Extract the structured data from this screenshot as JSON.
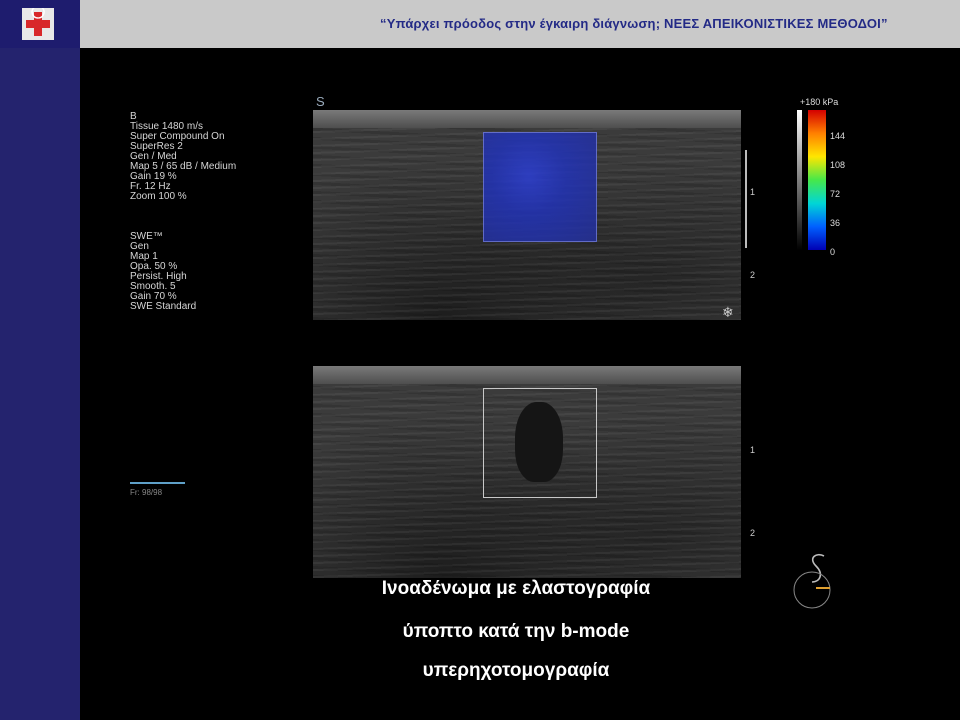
{
  "header": {
    "title": "“Υπάρχει πρόοδος στην έγκαιρη διάγνωση; ΝΕΕΣ ΑΠΕΙΚΟΝΙΣΤΙΚΕΣ ΜΕΘΟΔΟΙ”"
  },
  "params": {
    "bmode": [
      "B",
      "Tissue 1480 m/s",
      "Super Compound On",
      "SuperRes 2",
      "Gen / Med",
      "Map 5 / 65 dB / Medium",
      "Gain 19 %",
      "Fr. 12 Hz",
      "Zoom 100 %"
    ],
    "swe": [
      "SWE™",
      "Gen",
      "Map 1",
      "Opa. 50 %",
      "Persist. High",
      "Smooth. 5",
      "Gain 70 %",
      "SWE Standard"
    ]
  },
  "colorbar": {
    "labels": [
      "+180 kPa",
      "144",
      "108",
      "72",
      "36",
      "0"
    ]
  },
  "depth": {
    "top": [
      "1",
      "2"
    ],
    "bottom": [
      "1",
      "2"
    ]
  },
  "frame_counter": "Fr: 98/98",
  "caption": [
    "Ινοαδένωμα με ελαστογραφία",
    "ύποπτο κατά την  b-mode",
    "υπερηχοτομογραφία"
  ],
  "colors": {
    "header_bg": "#c9c9c9",
    "title_color": "#232a86",
    "sidebar_bg": "#24236e"
  }
}
